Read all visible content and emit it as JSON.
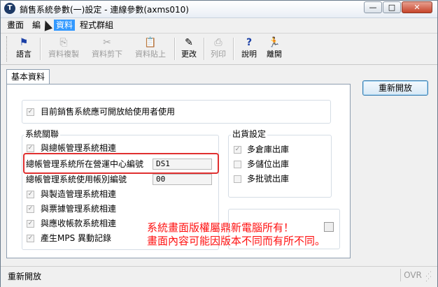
{
  "window": {
    "title": "銷售系統參數(一)設定 - 連線參數(axms010)",
    "app_icon": "T",
    "controls": {
      "minimize": "—",
      "maximize": "□",
      "close": "✕"
    }
  },
  "menu": [
    {
      "label": "畫面"
    },
    {
      "label": "編"
    },
    {
      "label": "資料"
    },
    {
      "label": "程式群組"
    }
  ],
  "toolbar": [
    {
      "label": "語言",
      "icon": "flag-icon",
      "glyph": "⚑",
      "enabled": true
    },
    {
      "label": "資料複製",
      "icon": "copy-icon",
      "glyph": "⎘",
      "enabled": false
    },
    {
      "label": "資料剪下",
      "icon": "scissors-icon",
      "glyph": "✂",
      "enabled": false
    },
    {
      "label": "資料貼上",
      "icon": "paste-icon",
      "glyph": "📋",
      "enabled": false
    },
    {
      "label": "更改",
      "icon": "pencil-icon",
      "glyph": "✎",
      "enabled": true
    },
    {
      "label": "列印",
      "icon": "printer-icon",
      "glyph": "⎙",
      "enabled": false
    },
    {
      "label": "說明",
      "icon": "help-icon",
      "glyph": "?",
      "enabled": true
    },
    {
      "label": "離開",
      "icon": "exit-icon",
      "glyph": "🏃",
      "enabled": true
    }
  ],
  "tab": {
    "label": "基本資料"
  },
  "reopen_button": {
    "label": "重新開放"
  },
  "top_option": {
    "label": "目前銷售系統應可開放給使用者使用",
    "checked": true
  },
  "system_group": {
    "title": "系統關聯",
    "items": [
      {
        "label": "與總帳管理系統相連",
        "checked": true
      },
      {
        "label": "總帳管理系統所在營運中心編號",
        "value": "DS1"
      },
      {
        "label": "總帳管理系統使用帳別編號",
        "value": "00"
      },
      {
        "label": "與製造管理系統相連",
        "checked": true
      },
      {
        "label": "與票據管理系統相連",
        "checked": true
      },
      {
        "label": "與應收帳款系統相連",
        "checked": true
      },
      {
        "label": "產生MPS 異動記錄",
        "checked": true
      }
    ]
  },
  "shipping_group": {
    "title": "出貨設定",
    "items": [
      {
        "label": "多倉庫出庫",
        "checked": true
      },
      {
        "label": "多儲位出庫",
        "checked": false
      },
      {
        "label": "多批號出庫",
        "checked": false
      }
    ]
  },
  "overlay": {
    "line1": "系統畫面版權屬鼎新電腦所有！",
    "line2": "畫面內容可能因版本不同而有所不同。",
    "color": "#ff1010"
  },
  "status": {
    "text": "重新開放",
    "mode": "OVR"
  }
}
